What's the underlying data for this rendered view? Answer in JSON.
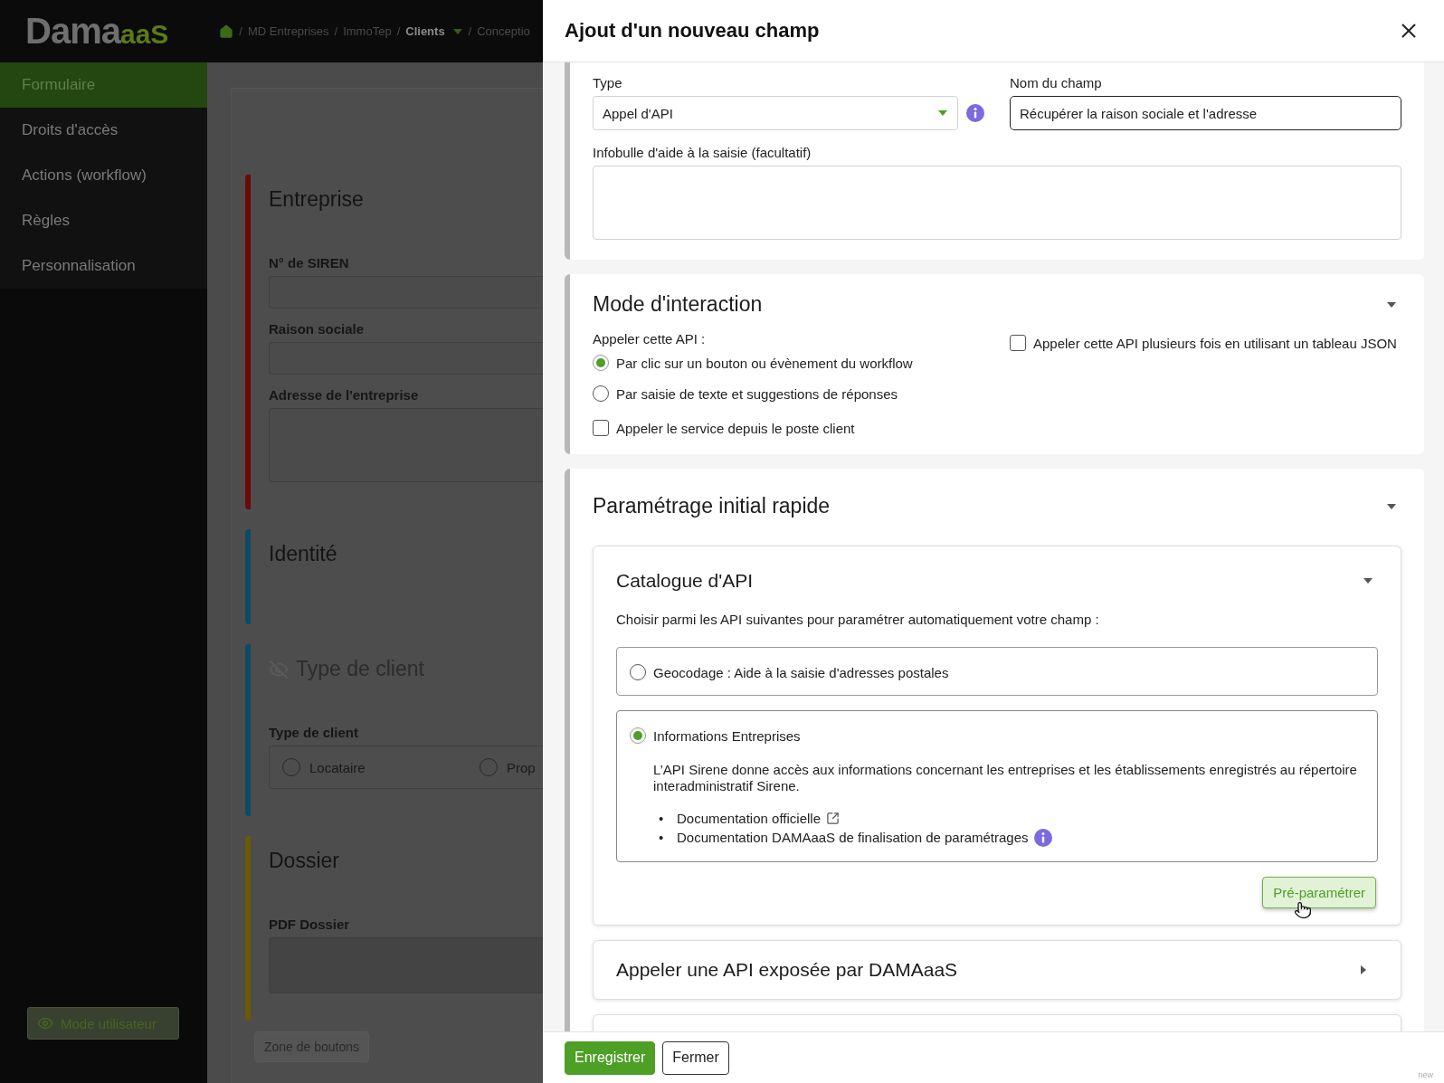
{
  "app_header": {
    "logo": {
      "main": "Dama",
      "suffix": "aaS"
    },
    "breadcrumb": [
      {
        "label": "MD Entreprises",
        "separator": "/",
        "current": false,
        "dropdown": false
      },
      {
        "label": "ImmoTep",
        "separator": "/",
        "current": false,
        "dropdown": false
      },
      {
        "label": "Clients",
        "separator": "/",
        "current": true,
        "dropdown": true
      },
      {
        "label": "Conceptio",
        "separator": "/",
        "current": false,
        "dropdown": false
      }
    ]
  },
  "sidebar": {
    "items": [
      {
        "label": "Formulaire",
        "selected": true
      },
      {
        "label": "Droits d'accès",
        "selected": false
      },
      {
        "label": "Actions (workflow)",
        "selected": false
      },
      {
        "label": "Règles",
        "selected": false
      },
      {
        "label": "Personnalisation",
        "selected": false
      }
    ],
    "mode_button": "Mode utilisateur"
  },
  "form_preview": {
    "sections": [
      {
        "title": "Entreprise",
        "color": "#6e0808",
        "hidden": false,
        "fields": [
          {
            "label": "N° de SIREN",
            "kind": "text"
          },
          {
            "label": "Raison sociale",
            "kind": "text"
          },
          {
            "label": "Adresse de l'entreprise",
            "kind": "textarea"
          }
        ]
      },
      {
        "title": "Identité",
        "color": "#0d4a66",
        "hidden": false
      },
      {
        "title": "Type de client",
        "color": "#0d4a66",
        "hidden": true,
        "fields": [
          {
            "label": "Type de client",
            "kind": "radio",
            "options": [
              {
                "label": "Locataire",
                "selected": false
              },
              {
                "label": "Prop",
                "selected": false
              }
            ]
          }
        ]
      },
      {
        "title": "Dossier",
        "color": "#6b5a00",
        "hidden": false,
        "fields": [
          {
            "label": "PDF Dossier",
            "kind": "file"
          }
        ]
      }
    ],
    "zone_button": "Zone de boutons"
  },
  "drawer": {
    "title": "Ajout d'un nouveau champ",
    "general": {
      "type_label": "Type",
      "type_value": "Appel d'API",
      "name_label": "Nom du champ",
      "name_value": "Récupérer la raison sociale et l'adresse",
      "tooltip_label": "Infobulle d'aide à la saisie (facultatif)"
    },
    "interaction": {
      "title": "Mode d'interaction",
      "expanded": true,
      "prompt": "Appeler cette API :",
      "modes": [
        {
          "label": "Par clic sur un bouton ou évènement du workflow",
          "selected": true
        },
        {
          "label": "Par saisie de texte et suggestions de réponses",
          "selected": false
        }
      ],
      "client_call": {
        "label": "Appeler le service depuis le poste client",
        "checked": false
      },
      "multi_call": {
        "label": "Appeler cette API plusieurs fois en utilisant un tableau JSON",
        "checked": false
      }
    },
    "quick_setup": {
      "title": "Paramétrage initial rapide",
      "expanded": true,
      "catalog": {
        "title": "Catalogue d'API",
        "expanded": true,
        "intro": "Choisir parmi les API suivantes pour paramétrer automatiquement votre champ :",
        "apis": [
          {
            "name": "Geocodage : Aide à la saisie d'adresses postales",
            "selected": false
          },
          {
            "name": "Informations Entreprises",
            "selected": true,
            "description": "L’API Sirene donne accès aux informations concernant les entreprises et les établissements enregistrés au répertoire interadministratif Sirene.",
            "links": [
              {
                "marker": "•",
                "label": "Documentation officielle",
                "kind": "external"
              },
              {
                "marker": "•",
                "label": "Documentation DAMAaaS de finalisation de paramétrages",
                "kind": "info"
              }
            ]
          }
        ],
        "action": "Pré-paramétrer"
      },
      "panels": [
        {
          "title": "Appeler une API exposée par DAMAaaS",
          "expanded": false
        }
      ]
    },
    "footer": {
      "buttons": [
        {
          "label": "Enregistrer",
          "kind": "primary"
        },
        {
          "label": "Fermer",
          "kind": "secondary"
        }
      ],
      "note": "new"
    }
  }
}
